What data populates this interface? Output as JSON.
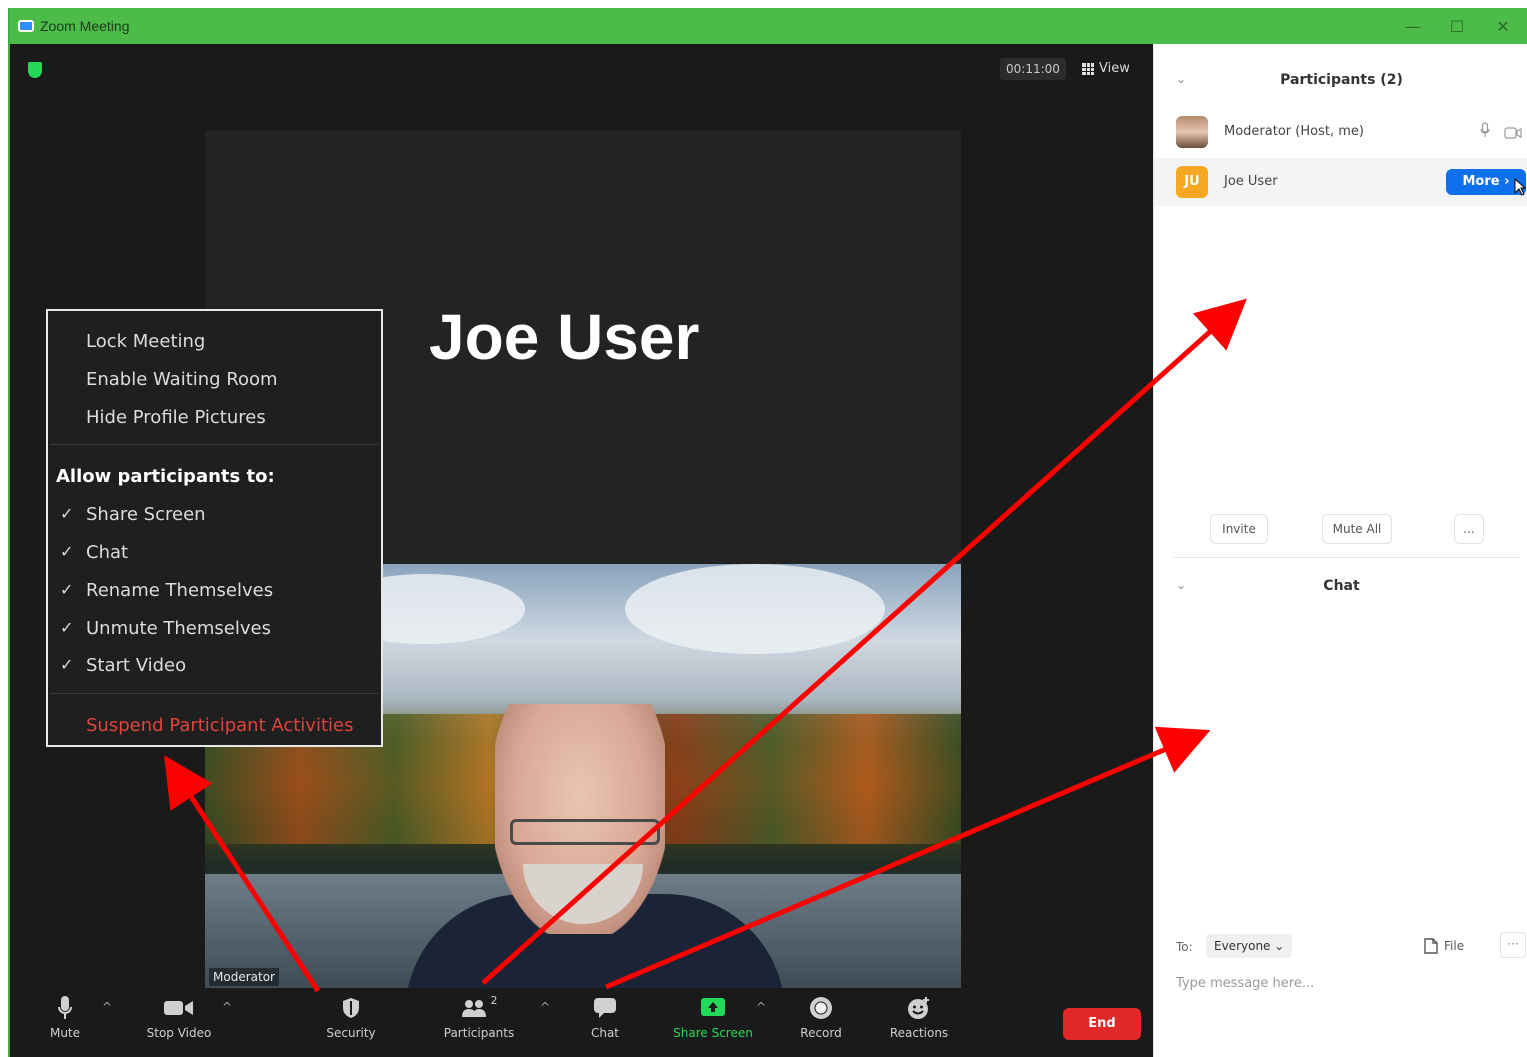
{
  "window": {
    "title": "Zoom Meeting",
    "controls": [
      "—",
      "☐",
      "✕"
    ]
  },
  "meeting": {
    "timer": "00:11:00",
    "view_label": "View",
    "speaker_name": "Joe User",
    "self_label": "Moderator"
  },
  "security_menu": {
    "items": [
      "Lock Meeting",
      "Enable Waiting Room",
      "Hide Profile Pictures"
    ],
    "allow_header": "Allow participants to:",
    "allow_items": [
      "Share Screen",
      "Chat",
      "Rename Themselves",
      "Unmute Themselves",
      "Start Video"
    ],
    "suspend": "Suspend Participant Activities",
    "check_glyph": "✓"
  },
  "toolbar": {
    "mute": "Mute",
    "stop_video": "Stop Video",
    "security": "Security",
    "participants": "Participants",
    "participants_count": "2",
    "chat": "Chat",
    "share_screen": "Share Screen",
    "record": "Record",
    "reactions": "Reactions",
    "end": "End",
    "caret": "^"
  },
  "participants_panel": {
    "title": "Participants (2)",
    "participants": [
      {
        "name": "Moderator (Host, me)",
        "avatar": "photo"
      },
      {
        "name": "Joe User",
        "initials": "JU",
        "avatar_color": "#f7a823"
      }
    ],
    "more_button": "More ›",
    "invite": "Invite",
    "mute_all": "Mute All",
    "more_dots": "..."
  },
  "chat_panel": {
    "title": "Chat",
    "to_label": "To:",
    "to_value": "Everyone ⌄",
    "file_label": "File",
    "more_dots": "···",
    "placeholder": "Type message here..."
  },
  "colors": {
    "titlebar": "#4cbb47",
    "end": "#e02828",
    "more": "#0e71eb",
    "share_green": "#23d959",
    "arrow": "#ff0000"
  }
}
